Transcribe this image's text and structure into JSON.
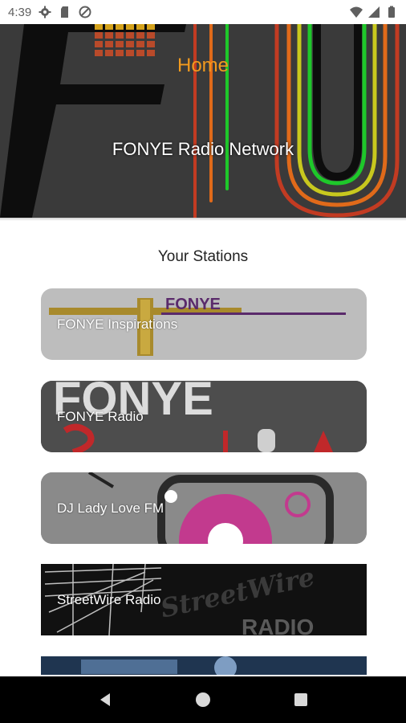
{
  "status_bar": {
    "time": "4:39",
    "left_icons": [
      "settings-icon",
      "sd-card-icon",
      "do-not-disturb-icon"
    ],
    "right_icons": [
      "wifi-icon",
      "signal-icon",
      "battery-icon"
    ]
  },
  "header": {
    "title": "Home",
    "subtitle": "FONYE Radio Network"
  },
  "section_title": "Your Stations",
  "stations": [
    {
      "name": "FONYE Inspirations"
    },
    {
      "name": "FONYE Radio"
    },
    {
      "name": "DJ Lady Love FM"
    },
    {
      "name": "StreetWire Radio"
    }
  ],
  "nav_bar": {
    "buttons": [
      "back-icon",
      "home-icon",
      "recents-icon"
    ]
  }
}
